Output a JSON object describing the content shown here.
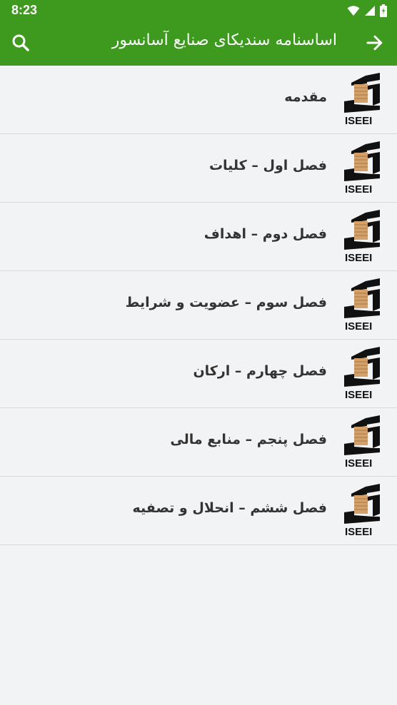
{
  "status_bar": {
    "time": "8:23",
    "icons": [
      "wifi-icon",
      "signal-icon",
      "battery-icon"
    ]
  },
  "app_bar": {
    "title": "اساسنامه سندیکای صنایع آسانسور",
    "back_icon": "arrow-forward-icon",
    "search_icon": "search-icon"
  },
  "colors": {
    "primary": "#3d9a1f",
    "background": "#f2f3f5",
    "divider": "#d9d9d9",
    "text": "#333333"
  },
  "list": {
    "logo_text": "ISEEI",
    "items": [
      {
        "label": "مقدمه"
      },
      {
        "label": "فصل اول – کلیات"
      },
      {
        "label": "فصل دوم – اهداف"
      },
      {
        "label": "فصل سوم – عضویت و شرایط"
      },
      {
        "label": "فصل چهارم – ارکان"
      },
      {
        "label": "فصل پنجم – منابع مالی"
      },
      {
        "label": "فصل ششم – انحلال و تصفیه"
      }
    ]
  }
}
